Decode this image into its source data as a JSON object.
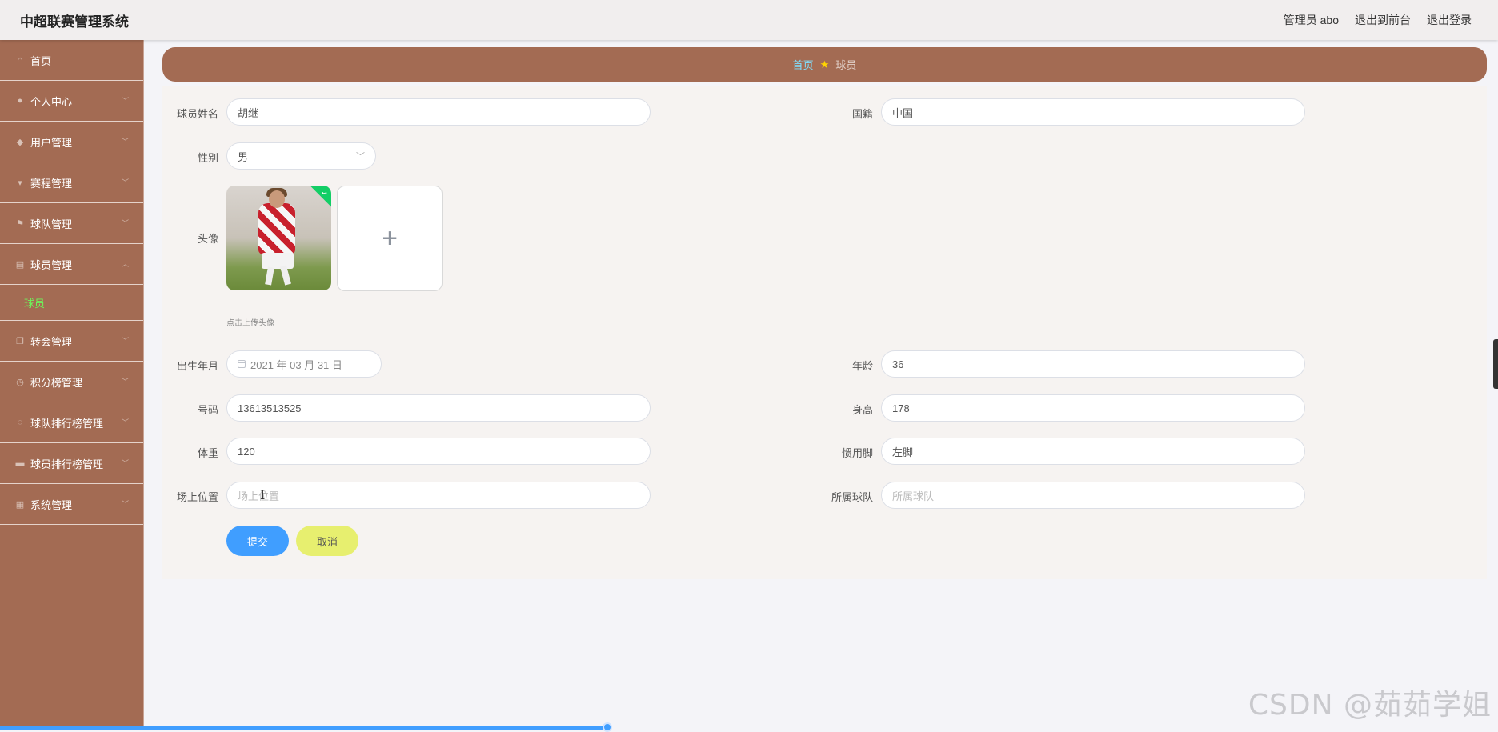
{
  "app": {
    "title": "中超联赛管理系统",
    "top_actions": [
      "管理员 abo",
      "退出到前台",
      "退出登录"
    ]
  },
  "sidebar": {
    "items": [
      {
        "label": "首页",
        "icon": "home-icon",
        "has_chevron": false
      },
      {
        "label": "个人中心",
        "icon": "user-icon",
        "has_chevron": true
      },
      {
        "label": "用户管理",
        "icon": "pin-icon",
        "has_chevron": true
      },
      {
        "label": "赛程管理",
        "icon": "trophy-icon",
        "has_chevron": true
      },
      {
        "label": "球队管理",
        "icon": "flag-icon",
        "has_chevron": true
      },
      {
        "label": "球员管理",
        "icon": "clipboard-icon",
        "has_chevron": true,
        "expanded": true,
        "children": [
          "球员"
        ]
      },
      {
        "label": "转会管理",
        "icon": "copy-icon",
        "has_chevron": true
      },
      {
        "label": "积分榜管理",
        "icon": "clock-icon",
        "has_chevron": true
      },
      {
        "label": "球队排行榜管理",
        "icon": "spinner-icon",
        "has_chevron": true
      },
      {
        "label": "球员排行榜管理",
        "icon": "chat-icon",
        "has_chevron": true
      },
      {
        "label": "系统管理",
        "icon": "grid-icon",
        "has_chevron": true
      }
    ],
    "active_child": "球员"
  },
  "breadcrumb": {
    "home": "首页",
    "current": "球员"
  },
  "form": {
    "player_name": {
      "label": "球员姓名",
      "value": "胡继"
    },
    "nationality": {
      "label": "国籍",
      "value": "中国"
    },
    "gender": {
      "label": "性别",
      "value": "男"
    },
    "avatar": {
      "label": "头像",
      "tip": "点击上传头像",
      "add_symbol": "+"
    },
    "birth": {
      "label": "出生年月",
      "value": "2021 年 03 月 31 日"
    },
    "age": {
      "label": "年龄",
      "value": "36"
    },
    "number": {
      "label": "号码",
      "value": "13613513525"
    },
    "height": {
      "label": "身高",
      "value": "178"
    },
    "weight": {
      "label": "体重",
      "value": "120"
    },
    "foot": {
      "label": "惯用脚",
      "value": "左脚"
    },
    "position": {
      "label": "场上位置",
      "placeholder": "场上位置"
    },
    "team": {
      "label": "所属球队",
      "placeholder": "所属球队"
    },
    "submit": "提交",
    "cancel": "取消"
  },
  "watermark": "CSDN @茹茹学姐",
  "colors": {
    "sidebar": "#a36b53",
    "breadcrumb_home": "#7fe0ff",
    "active_submenu": "#6ef55a",
    "primary": "#409eff",
    "cancel": "#e7ef6f"
  }
}
